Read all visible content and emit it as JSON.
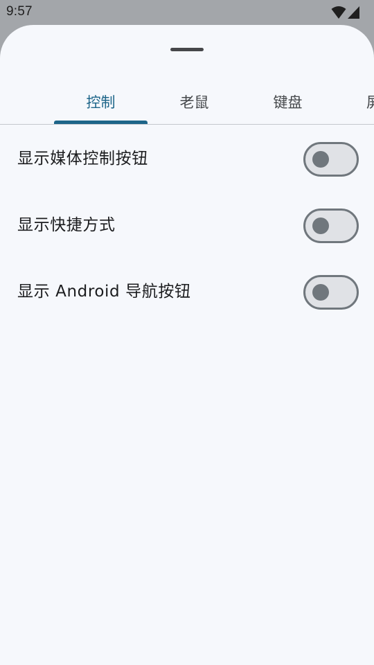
{
  "status_bar": {
    "time": "9:57",
    "icons": [
      "wifi-icon",
      "cellular-signal-icon"
    ]
  },
  "tabs": [
    {
      "label": "控制",
      "active": true
    },
    {
      "label": "老鼠",
      "active": false
    },
    {
      "label": "键盘",
      "active": false
    },
    {
      "label": "屏",
      "active": false
    }
  ],
  "settings": [
    {
      "label": "显示媒体控制按钮",
      "enabled": false
    },
    {
      "label": "显示快捷方式",
      "enabled": false
    },
    {
      "label": "显示 Android 导航按钮",
      "enabled": false
    }
  ],
  "colors": {
    "accent": "#1d6589",
    "sheet_background": "#f6f8fc",
    "scrim": "#a3a6aa",
    "switch_off_track": "#e0e2e6",
    "switch_off_thumb": "#70777d"
  }
}
